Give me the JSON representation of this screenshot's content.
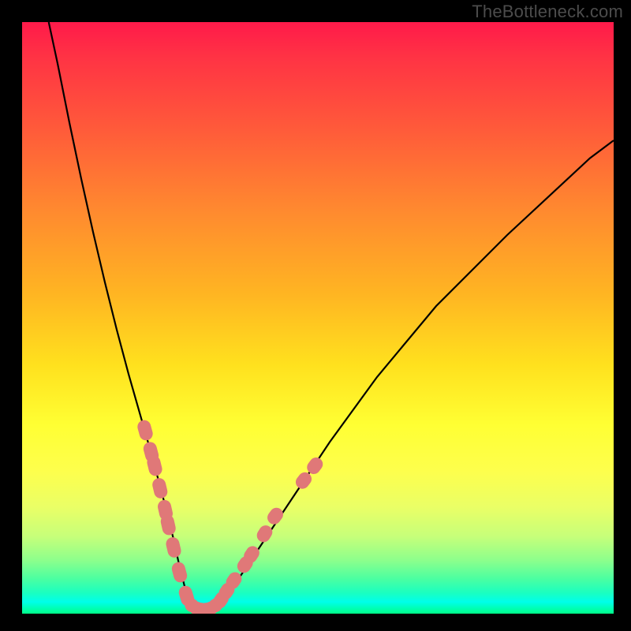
{
  "watermark": "TheBottleneck.com",
  "chart_data": {
    "type": "line",
    "title": "",
    "xlabel": "",
    "ylabel": "",
    "xlim": [
      0,
      100
    ],
    "ylim": [
      0,
      100
    ],
    "grid": false,
    "legend": false,
    "background_gradient": {
      "direction": "vertical",
      "stops": [
        {
          "pos": 0.0,
          "color": "#ff1a4a"
        },
        {
          "pos": 0.06,
          "color": "#ff3344"
        },
        {
          "pos": 0.18,
          "color": "#ff5a3a"
        },
        {
          "pos": 0.32,
          "color": "#ff8a2f"
        },
        {
          "pos": 0.46,
          "color": "#ffb522"
        },
        {
          "pos": 0.58,
          "color": "#ffe11e"
        },
        {
          "pos": 0.68,
          "color": "#ffff33"
        },
        {
          "pos": 0.76,
          "color": "#fdff4d"
        },
        {
          "pos": 0.82,
          "color": "#eaff66"
        },
        {
          "pos": 0.87,
          "color": "#c6ff7a"
        },
        {
          "pos": 0.91,
          "color": "#8cff8c"
        },
        {
          "pos": 0.94,
          "color": "#4dffa0"
        },
        {
          "pos": 0.965,
          "color": "#1affc0"
        },
        {
          "pos": 0.98,
          "color": "#00ffea"
        },
        {
          "pos": 1.0,
          "color": "#00ff88"
        }
      ]
    },
    "series": [
      {
        "name": "bottleneck-curve",
        "color": "#000000",
        "x": [
          4.5,
          6,
          8,
          10,
          12,
          14,
          16,
          18,
          20,
          22,
          24,
          25.5,
          26.5,
          27.5,
          29,
          30.5,
          32,
          34,
          37,
          41,
          46,
          52,
          60,
          70,
          82,
          96,
          100
        ],
        "y": [
          100,
          93,
          83,
          73.5,
          64.5,
          56,
          48,
          40.5,
          33.5,
          26.5,
          19,
          13,
          8.5,
          4.5,
          1.5,
          0.7,
          0.9,
          2.5,
          6.5,
          12.5,
          20,
          29,
          40,
          52,
          64,
          77,
          80
        ]
      }
    ],
    "markers": {
      "name": "highlighted-range",
      "color": "#e07878",
      "style": "pill",
      "points_left_branch": [
        {
          "x": 20.8,
          "y": 31.0
        },
        {
          "x": 21.8,
          "y": 27.3
        },
        {
          "x": 22.4,
          "y": 25.0
        },
        {
          "x": 23.3,
          "y": 21.2
        },
        {
          "x": 24.2,
          "y": 17.5
        },
        {
          "x": 24.7,
          "y": 15.0
        },
        {
          "x": 25.6,
          "y": 11.2
        },
        {
          "x": 26.6,
          "y": 7.0
        },
        {
          "x": 27.8,
          "y": 3.0
        }
      ],
      "points_bottom": [
        {
          "x": 28.7,
          "y": 1.4
        },
        {
          "x": 29.5,
          "y": 0.9
        },
        {
          "x": 30.3,
          "y": 0.7
        },
        {
          "x": 31.1,
          "y": 0.7
        },
        {
          "x": 31.9,
          "y": 0.9
        },
        {
          "x": 32.7,
          "y": 1.4
        }
      ],
      "points_right_branch": [
        {
          "x": 33.6,
          "y": 2.3
        },
        {
          "x": 34.6,
          "y": 3.8
        },
        {
          "x": 35.8,
          "y": 5.6
        },
        {
          "x": 37.7,
          "y": 8.3
        },
        {
          "x": 38.8,
          "y": 10.0
        },
        {
          "x": 41.0,
          "y": 13.5
        },
        {
          "x": 42.8,
          "y": 16.5
        },
        {
          "x": 47.6,
          "y": 22.5
        },
        {
          "x": 49.5,
          "y": 25.0
        }
      ]
    }
  }
}
